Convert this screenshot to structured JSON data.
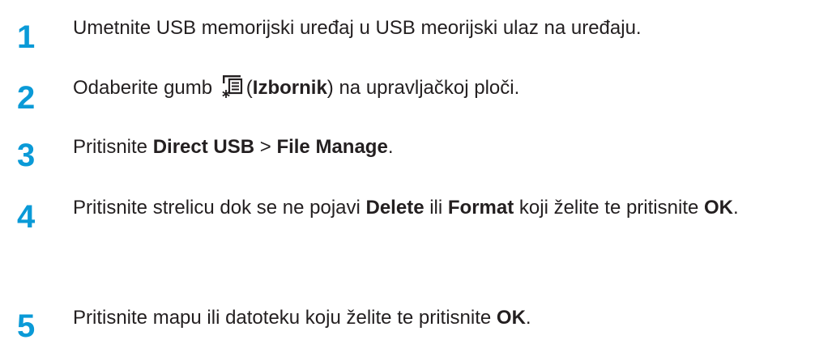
{
  "steps": [
    {
      "number": "1",
      "parts": [
        "Umetnite USB memorijski uređaj u USB meorijski ulaz na uređaju."
      ]
    },
    {
      "number": "2",
      "before": "Odaberite gumb ",
      "icon": "menu-icon",
      "after_open": "(",
      "bold": "Izbornik",
      "after_close": ") na upravljačkoj ploči."
    },
    {
      "number": "3",
      "before": "Pritisnite ",
      "bold1": "Direct USB",
      "mid": " > ",
      "bold2": "File Manage",
      "after": "."
    },
    {
      "number": "4",
      "before": "Pritisnite strelicu dok se ne pojavi ",
      "bold1": "Delete",
      "mid1": " ili ",
      "bold2": "Format",
      "mid2": " koji želite te pritisnite ",
      "bold3": "OK",
      "after": "."
    },
    {
      "number": "5",
      "before": "Pritisnite mapu ili datoteku koju želite te pritisnite ",
      "bold": "OK",
      "after": "."
    }
  ],
  "colors": {
    "step_number": "#0a9ad7",
    "text": "#231f20"
  }
}
